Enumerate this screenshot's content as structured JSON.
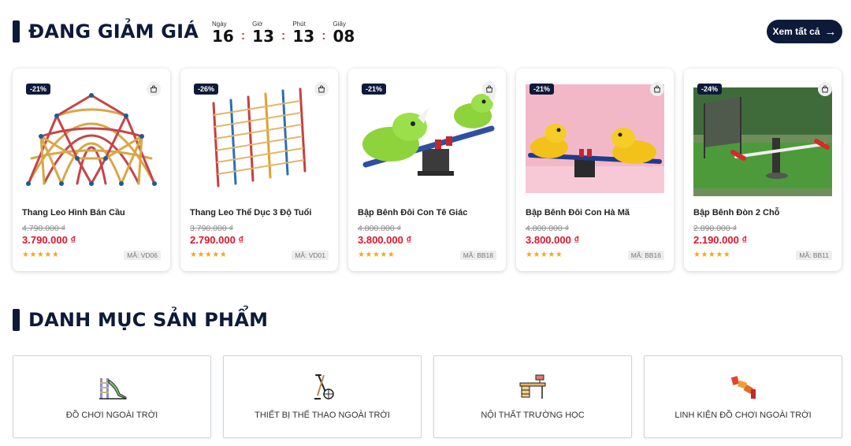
{
  "sale": {
    "title": "ĐANG GIẢM GIÁ",
    "countdown": [
      {
        "label": "Ngày",
        "value": "16"
      },
      {
        "label": "Giờ",
        "value": "13"
      },
      {
        "label": "Phút",
        "value": "13"
      },
      {
        "label": "Giây",
        "value": "08"
      }
    ],
    "separator": ":",
    "view_all": "Xem tất cả"
  },
  "products": [
    {
      "discount": "-21%",
      "name": "Thang Leo Hình Bán Cầu",
      "old_price": "4.790.000 ₫",
      "price": "3.790.000 ₫",
      "rating": 5,
      "code": "MÃ: VD06"
    },
    {
      "discount": "-26%",
      "name": "Thang Leo Thể Dục 3 Độ Tuổi",
      "old_price": "3.790.000 ₫",
      "price": "2.790.000 ₫",
      "rating": 5,
      "code": "MÃ: VD01"
    },
    {
      "discount": "-21%",
      "name": "Bập Bênh Đôi Con Tê Giác",
      "old_price": "4.800.000 ₫",
      "price": "3.800.000 ₫",
      "rating": 5,
      "code": "MÃ: BB18"
    },
    {
      "discount": "-21%",
      "name": "Bập Bênh Đôi Con Hà Mã",
      "old_price": "4.800.000 ₫",
      "price": "3.800.000 ₫",
      "rating": 5,
      "code": "MÃ: BB16"
    },
    {
      "discount": "-24%",
      "name": "Bập Bênh Đòn 2 Chỗ",
      "old_price": "2.890.000 ₫",
      "price": "2.190.000 ₫",
      "rating": 5,
      "code": "MÃ: BB11"
    }
  ],
  "categories_section": {
    "title": "DANH MỤC SẢN PHẨM",
    "items": [
      {
        "label": "ĐỒ CHƠI NGOÀI TRỜI",
        "icon": "slide-icon"
      },
      {
        "label": "THIẾT BỊ THỂ THAO NGOÀI TRỜI",
        "icon": "sports-equipment-icon"
      },
      {
        "label": "NỘI THẤT TRƯỜNG HỌC",
        "icon": "school-desk-icon"
      },
      {
        "label": "LINH KIỆN ĐỒ CHƠI NGOÀI TRỜI",
        "icon": "playground-parts-icon"
      }
    ]
  },
  "colors": {
    "brand": "#0d1a3a",
    "price": "#e0142c",
    "star": "#f5a623"
  }
}
